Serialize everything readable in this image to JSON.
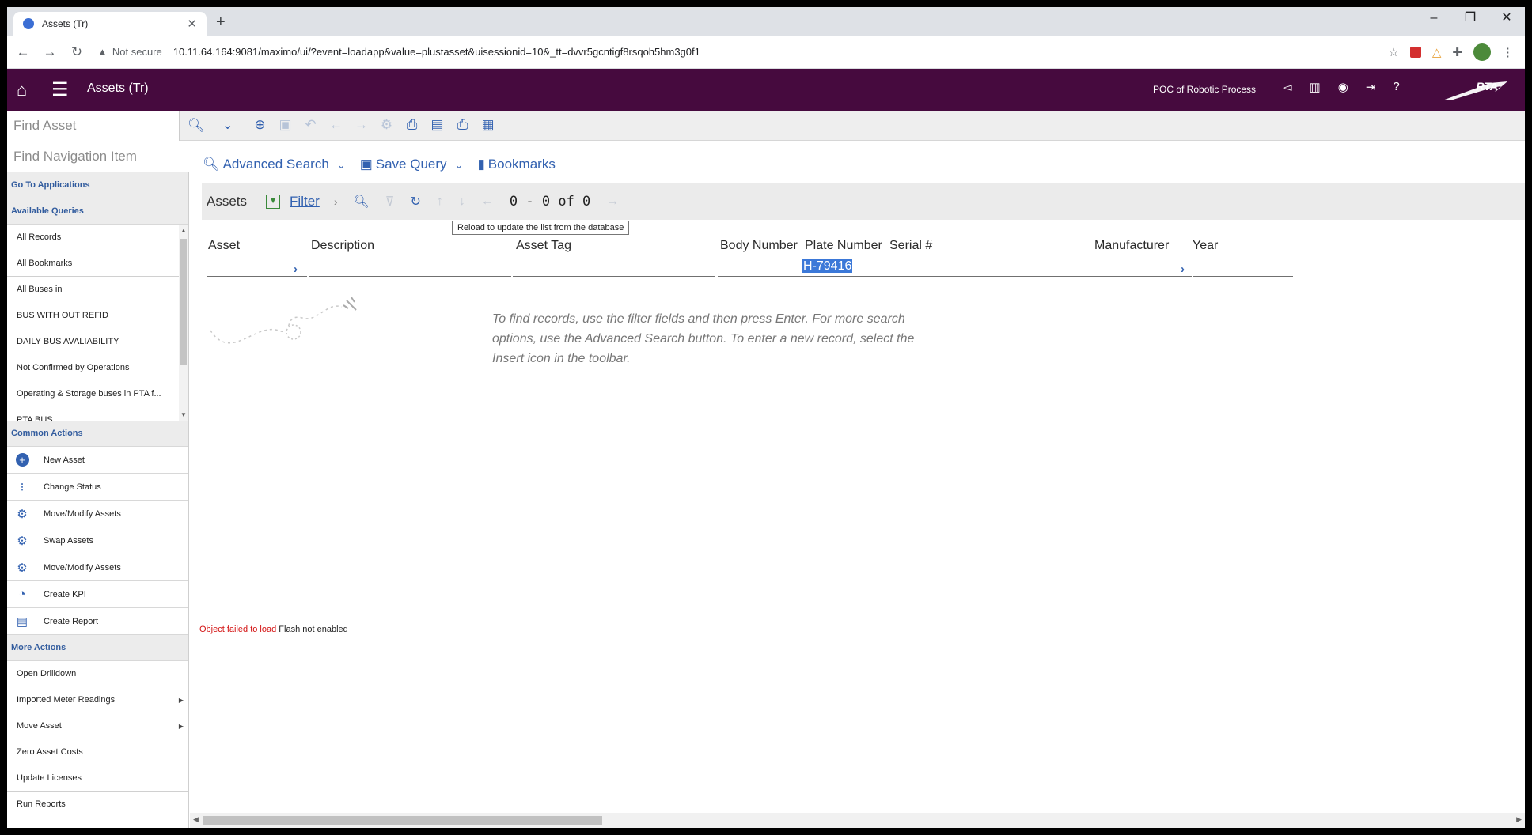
{
  "browser": {
    "tab_title": "Assets (Tr)",
    "new_tab": "+",
    "tab_close": "✕",
    "security": "Not secure",
    "url": "10.11.64.164:9081/maximo/ui/?event=loadapp&value=plustasset&uisessionid=10&_tt=dvvr5gcntigf8rsqoh5hm3g0f1",
    "window_controls": [
      "–",
      "❐",
      "✕"
    ]
  },
  "header": {
    "app_title": "Assets (Tr)",
    "org_label": "POC of Robotic Process",
    "logo_text": "RTA"
  },
  "find_asset": {
    "placeholder": "Find Asset"
  },
  "sidebar": {
    "nav_placeholder": "Find Navigation Item",
    "go_to_apps": "Go To Applications",
    "available_queries": "Available Queries",
    "queries": [
      "All Records",
      "All Bookmarks",
      "All Buses in",
      "BUS WITH OUT REFID",
      "DAILY BUS AVALIABILITY",
      "Not Confirmed by Operations",
      "Operating & Storage buses in PTA f...",
      "PTA BUS"
    ],
    "common_actions": "Common Actions",
    "actions": [
      "New Asset",
      "Change Status",
      "Move/Modify Assets",
      "Swap Assets",
      "Move/Modify Assets",
      "Create KPI",
      "Create Report"
    ],
    "more_actions": "More Actions",
    "more": [
      "Open Drilldown",
      "Imported Meter Readings",
      "Move Asset",
      "Zero Asset Costs",
      "Update Licenses",
      "Run Reports"
    ]
  },
  "query_bar": {
    "advanced_search": "Advanced Search",
    "save_query": "Save Query",
    "bookmarks": "Bookmarks"
  },
  "list": {
    "title": "Assets",
    "filter": "Filter",
    "count": "0 - 0 of 0",
    "tooltip": "Reload to update the list from the database",
    "columns": [
      "Asset",
      "Description",
      "Asset Tag",
      "Body Number",
      "Plate Number",
      "Serial #",
      "Manufacturer",
      "Year"
    ],
    "plate_filter_value": "H-79416",
    "empty_message": "To find records, use the filter fields and then press Enter. For more search options, use the Advanced Search button. To enter a new record, select the Insert icon in the toolbar."
  },
  "flash": {
    "error": "Object failed to load",
    "detail": "Flash not enabled"
  },
  "colors": {
    "header_bg": "#460a3e",
    "accent": "#3261b0",
    "selection": "#3b78d8"
  }
}
